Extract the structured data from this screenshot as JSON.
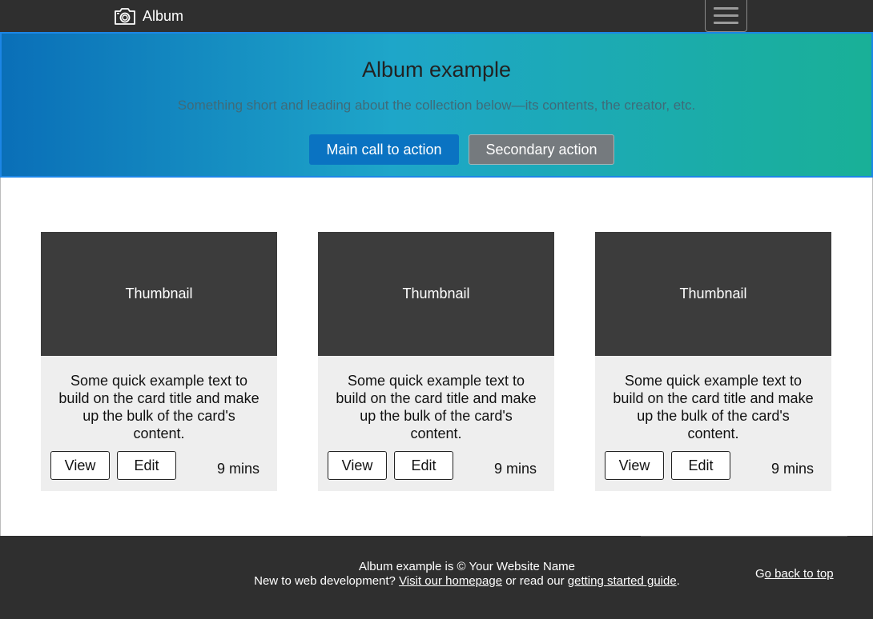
{
  "navbar": {
    "brand_label": "Album",
    "brand_icon": "camera-icon",
    "menu_icon": "hamburger-menu-icon"
  },
  "hero": {
    "title": "Album example",
    "lead": "Something short and leading about the collection below—its contents, the creator, etc.",
    "primary_label": "Main call to action",
    "secondary_label": "Secondary action"
  },
  "cards": [
    {
      "thumbnail_label": "Thumbnail",
      "text": "Some quick example text to build on the card title and make up the bulk of the card's content.",
      "view_label": "View",
      "edit_label": "Edit",
      "time": "9 mins"
    },
    {
      "thumbnail_label": "Thumbnail",
      "text": "Some quick example text to build on the card title and make up the bulk of the card's content.",
      "view_label": "View",
      "edit_label": "Edit",
      "time": "9 mins"
    },
    {
      "thumbnail_label": "Thumbnail",
      "text": "Some quick example text to build on the card title and make up the bulk of the card's content.",
      "view_label": "View",
      "edit_label": "Edit",
      "time": "9 mins"
    }
  ],
  "footer": {
    "copyright": "Album example is © Your Website Name",
    "help_prefix": "New to web development? ",
    "homepage_link": "Visit our homepage",
    "help_middle": " or read our ",
    "guide_link": "getting started guide",
    "help_suffix": ".",
    "back_to_top_g": "G",
    "back_to_top_rest": "o back to top"
  },
  "colors": {
    "navbar_bg": "#2f2f2f",
    "hero_gradient_start": "#0a6fb8",
    "hero_gradient_end": "#19b097",
    "primary_button": "#0a73c2",
    "secondary_button": "#757a7e",
    "thumbnail_bg": "#3c3c3c",
    "card_bg": "#eeeeee",
    "footer_bg": "#2f2f2f"
  }
}
